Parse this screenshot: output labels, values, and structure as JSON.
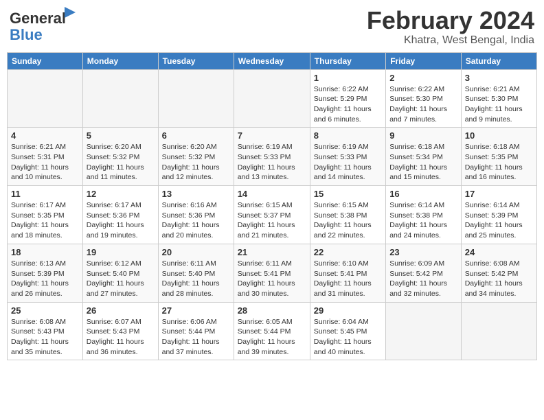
{
  "logo": {
    "general": "General",
    "blue": "Blue"
  },
  "title": "February 2024",
  "location": "Khatra, West Bengal, India",
  "days_header": [
    "Sunday",
    "Monday",
    "Tuesday",
    "Wednesday",
    "Thursday",
    "Friday",
    "Saturday"
  ],
  "weeks": [
    [
      {
        "day": "",
        "info": ""
      },
      {
        "day": "",
        "info": ""
      },
      {
        "day": "",
        "info": ""
      },
      {
        "day": "",
        "info": ""
      },
      {
        "day": "1",
        "info": "Sunrise: 6:22 AM\nSunset: 5:29 PM\nDaylight: 11 hours and 6 minutes."
      },
      {
        "day": "2",
        "info": "Sunrise: 6:22 AM\nSunset: 5:30 PM\nDaylight: 11 hours and 7 minutes."
      },
      {
        "day": "3",
        "info": "Sunrise: 6:21 AM\nSunset: 5:30 PM\nDaylight: 11 hours and 9 minutes."
      }
    ],
    [
      {
        "day": "4",
        "info": "Sunrise: 6:21 AM\nSunset: 5:31 PM\nDaylight: 11 hours and 10 minutes."
      },
      {
        "day": "5",
        "info": "Sunrise: 6:20 AM\nSunset: 5:32 PM\nDaylight: 11 hours and 11 minutes."
      },
      {
        "day": "6",
        "info": "Sunrise: 6:20 AM\nSunset: 5:32 PM\nDaylight: 11 hours and 12 minutes."
      },
      {
        "day": "7",
        "info": "Sunrise: 6:19 AM\nSunset: 5:33 PM\nDaylight: 11 hours and 13 minutes."
      },
      {
        "day": "8",
        "info": "Sunrise: 6:19 AM\nSunset: 5:33 PM\nDaylight: 11 hours and 14 minutes."
      },
      {
        "day": "9",
        "info": "Sunrise: 6:18 AM\nSunset: 5:34 PM\nDaylight: 11 hours and 15 minutes."
      },
      {
        "day": "10",
        "info": "Sunrise: 6:18 AM\nSunset: 5:35 PM\nDaylight: 11 hours and 16 minutes."
      }
    ],
    [
      {
        "day": "11",
        "info": "Sunrise: 6:17 AM\nSunset: 5:35 PM\nDaylight: 11 hours and 18 minutes."
      },
      {
        "day": "12",
        "info": "Sunrise: 6:17 AM\nSunset: 5:36 PM\nDaylight: 11 hours and 19 minutes."
      },
      {
        "day": "13",
        "info": "Sunrise: 6:16 AM\nSunset: 5:36 PM\nDaylight: 11 hours and 20 minutes."
      },
      {
        "day": "14",
        "info": "Sunrise: 6:15 AM\nSunset: 5:37 PM\nDaylight: 11 hours and 21 minutes."
      },
      {
        "day": "15",
        "info": "Sunrise: 6:15 AM\nSunset: 5:38 PM\nDaylight: 11 hours and 22 minutes."
      },
      {
        "day": "16",
        "info": "Sunrise: 6:14 AM\nSunset: 5:38 PM\nDaylight: 11 hours and 24 minutes."
      },
      {
        "day": "17",
        "info": "Sunrise: 6:14 AM\nSunset: 5:39 PM\nDaylight: 11 hours and 25 minutes."
      }
    ],
    [
      {
        "day": "18",
        "info": "Sunrise: 6:13 AM\nSunset: 5:39 PM\nDaylight: 11 hours and 26 minutes."
      },
      {
        "day": "19",
        "info": "Sunrise: 6:12 AM\nSunset: 5:40 PM\nDaylight: 11 hours and 27 minutes."
      },
      {
        "day": "20",
        "info": "Sunrise: 6:11 AM\nSunset: 5:40 PM\nDaylight: 11 hours and 28 minutes."
      },
      {
        "day": "21",
        "info": "Sunrise: 6:11 AM\nSunset: 5:41 PM\nDaylight: 11 hours and 30 minutes."
      },
      {
        "day": "22",
        "info": "Sunrise: 6:10 AM\nSunset: 5:41 PM\nDaylight: 11 hours and 31 minutes."
      },
      {
        "day": "23",
        "info": "Sunrise: 6:09 AM\nSunset: 5:42 PM\nDaylight: 11 hours and 32 minutes."
      },
      {
        "day": "24",
        "info": "Sunrise: 6:08 AM\nSunset: 5:42 PM\nDaylight: 11 hours and 34 minutes."
      }
    ],
    [
      {
        "day": "25",
        "info": "Sunrise: 6:08 AM\nSunset: 5:43 PM\nDaylight: 11 hours and 35 minutes."
      },
      {
        "day": "26",
        "info": "Sunrise: 6:07 AM\nSunset: 5:43 PM\nDaylight: 11 hours and 36 minutes."
      },
      {
        "day": "27",
        "info": "Sunrise: 6:06 AM\nSunset: 5:44 PM\nDaylight: 11 hours and 37 minutes."
      },
      {
        "day": "28",
        "info": "Sunrise: 6:05 AM\nSunset: 5:44 PM\nDaylight: 11 hours and 39 minutes."
      },
      {
        "day": "29",
        "info": "Sunrise: 6:04 AM\nSunset: 5:45 PM\nDaylight: 11 hours and 40 minutes."
      },
      {
        "day": "",
        "info": ""
      },
      {
        "day": "",
        "info": ""
      }
    ]
  ]
}
